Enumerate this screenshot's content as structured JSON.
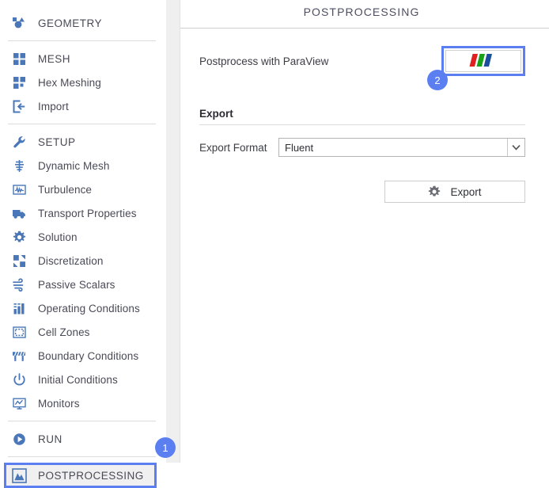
{
  "colors": {
    "accent": "#5b7ff0",
    "icon_blue": "#4a77b8",
    "text": "#4a4a57",
    "title": "#4e4e63",
    "logo_red": "#e02020",
    "logo_green": "#17a217",
    "logo_blue": "#1b4f9c"
  },
  "sidebar": {
    "groups": [
      {
        "items": [
          {
            "label": "GEOMETRY",
            "icon": "geometry-icon",
            "heading": true,
            "selected": false
          }
        ]
      },
      {
        "items": [
          {
            "label": "MESH",
            "icon": "mesh-grid-icon",
            "heading": true,
            "selected": false
          },
          {
            "label": "Hex Meshing",
            "icon": "hex-meshing-icon",
            "heading": false,
            "selected": false
          },
          {
            "label": "Import",
            "icon": "import-icon",
            "heading": false,
            "selected": false
          }
        ]
      },
      {
        "items": [
          {
            "label": "SETUP",
            "icon": "wrench-icon",
            "heading": true,
            "selected": false
          },
          {
            "label": "Dynamic Mesh",
            "icon": "dynamic-mesh-icon",
            "heading": false,
            "selected": false
          },
          {
            "label": "Turbulence",
            "icon": "turbulence-icon",
            "heading": false,
            "selected": false
          },
          {
            "label": "Transport Properties",
            "icon": "truck-icon",
            "heading": false,
            "selected": false
          },
          {
            "label": "Solution",
            "icon": "gear-icon",
            "heading": false,
            "selected": false
          },
          {
            "label": "Discretization",
            "icon": "discretization-icon",
            "heading": false,
            "selected": false
          },
          {
            "label": "Passive Scalars",
            "icon": "wind-icon",
            "heading": false,
            "selected": false
          },
          {
            "label": "Operating Conditions",
            "icon": "bar-chart-icon",
            "heading": false,
            "selected": false
          },
          {
            "label": "Cell Zones",
            "icon": "cell-zones-icon",
            "heading": false,
            "selected": false
          },
          {
            "label": "Boundary Conditions",
            "icon": "barrier-icon",
            "heading": false,
            "selected": false
          },
          {
            "label": "Initial Conditions",
            "icon": "power-clock-icon",
            "heading": false,
            "selected": false
          },
          {
            "label": "Monitors",
            "icon": "monitor-icon",
            "heading": false,
            "selected": false
          }
        ]
      },
      {
        "items": [
          {
            "label": "RUN",
            "icon": "play-icon",
            "heading": true,
            "selected": false
          }
        ]
      },
      {
        "items": [
          {
            "label": "POSTPROCESSING",
            "icon": "postprocessing-icon",
            "heading": true,
            "selected": true
          }
        ]
      }
    ]
  },
  "main": {
    "title": "POSTPROCESSING",
    "paraview": {
      "label": "Postprocess with ParaView",
      "button_icon": "paraview-logo-icon"
    },
    "export": {
      "heading": "Export",
      "format_label": "Export Format",
      "format_value": "Fluent",
      "format_options": [
        "Fluent"
      ],
      "arrow_icon": "chevron-down-icon",
      "button_label": "Export",
      "button_icon": "gear-icon"
    }
  },
  "badges": [
    {
      "number": "1"
    },
    {
      "number": "2"
    }
  ]
}
